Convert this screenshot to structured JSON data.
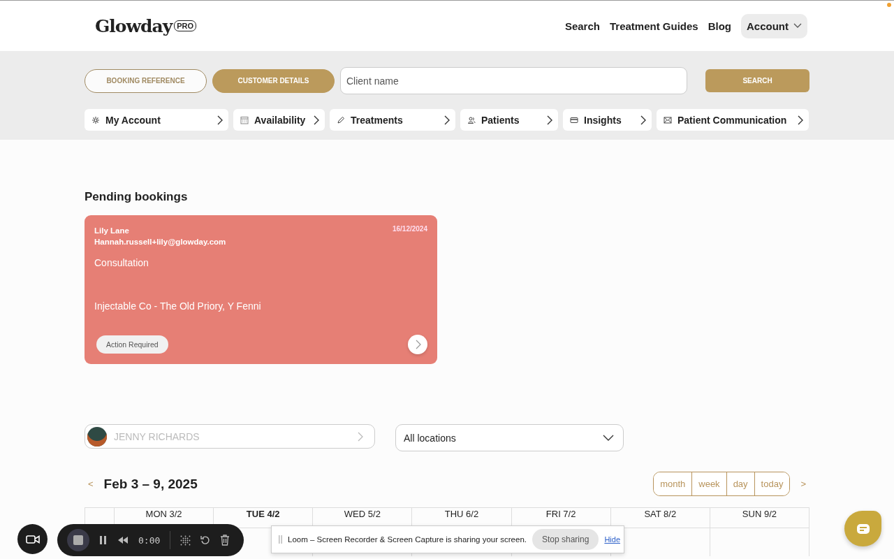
{
  "header": {
    "logo": "Glowday",
    "logo_badge": "PRO",
    "nav": [
      {
        "label": "Search"
      },
      {
        "label": "Treatment Guides"
      },
      {
        "label": "Blog"
      }
    ],
    "account": {
      "label": "Account"
    }
  },
  "search_bar": {
    "modes": [
      {
        "label": "BOOKING REFERENCE",
        "selected": false
      },
      {
        "label": "CUSTOMER DETAILS",
        "selected": true
      }
    ],
    "field": {
      "placeholder": "Client name"
    },
    "button": "SEARCH"
  },
  "menu": [
    {
      "label": "My Account"
    },
    {
      "label": "Availability"
    },
    {
      "label": "Treatments"
    },
    {
      "label": "Patients"
    },
    {
      "label": "Insights"
    },
    {
      "label": "Patient Communication"
    }
  ],
  "pending": {
    "title": "Pending bookings",
    "bookings": [
      {
        "name": "Lily Lane",
        "email": "Hannah.russell+lily@glowday.com",
        "date": "16/12/2024",
        "service": "Consultation",
        "location": "Injectable Co - The Old Priory, Y Fenni",
        "status": "Action Required",
        "color": "#e67f75"
      }
    ]
  },
  "filters": {
    "practitioner": {
      "name": "JENNY RICHARDS"
    },
    "location": {
      "value": "All locations"
    }
  },
  "calendar": {
    "prev": "<",
    "title": "Feb 3 – 9, 2025",
    "next": ">",
    "views": [
      {
        "label": "month",
        "selected": false
      },
      {
        "label": "week",
        "selected": false
      },
      {
        "label": "day",
        "selected": false
      },
      {
        "label": "today",
        "selected": false
      }
    ],
    "days": [
      {
        "label": "MON 3/2",
        "today": false
      },
      {
        "label": "TUE 4/2",
        "today": true
      },
      {
        "label": "WED 5/2",
        "today": false
      },
      {
        "label": "THU 6/2",
        "today": false
      },
      {
        "label": "FRI 7/2",
        "today": false
      },
      {
        "label": "SAT 8/2",
        "today": false
      },
      {
        "label": "SUN 9/2",
        "today": false
      }
    ]
  },
  "recorder": {
    "time": "0:00"
  },
  "sharing_bar": {
    "message": "Loom – Screen Recorder & Screen Capture is sharing your screen.",
    "stop": "Stop sharing",
    "hide": "Hide"
  }
}
